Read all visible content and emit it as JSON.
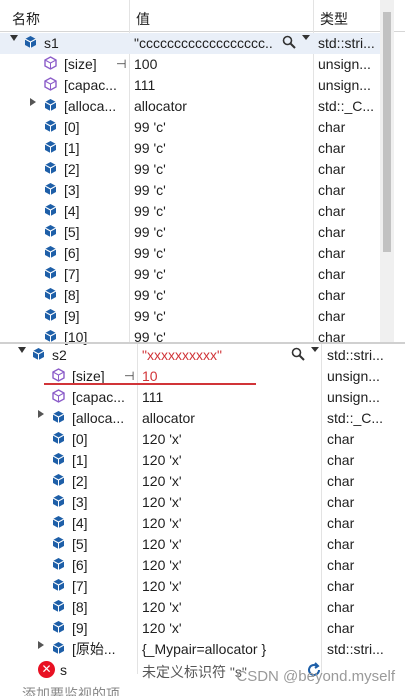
{
  "header": {
    "name": "名称",
    "value": "值",
    "type": "类型"
  },
  "s1": {
    "name": "s1",
    "value": "\"cccccccccccccccccc...",
    "type": "std::stri...",
    "rows": [
      {
        "name": "[size]",
        "value": "100",
        "type": "unsign..."
      },
      {
        "name": "[capac...",
        "value": "111",
        "type": "unsign..."
      },
      {
        "name": "[alloca...",
        "value": "allocator",
        "type": "std::_C..."
      },
      {
        "name": "[0]",
        "value": "99 'c'",
        "type": "char"
      },
      {
        "name": "[1]",
        "value": "99 'c'",
        "type": "char"
      },
      {
        "name": "[2]",
        "value": "99 'c'",
        "type": "char"
      },
      {
        "name": "[3]",
        "value": "99 'c'",
        "type": "char"
      },
      {
        "name": "[4]",
        "value": "99 'c'",
        "type": "char"
      },
      {
        "name": "[5]",
        "value": "99 'c'",
        "type": "char"
      },
      {
        "name": "[6]",
        "value": "99 'c'",
        "type": "char"
      },
      {
        "name": "[7]",
        "value": "99 'c'",
        "type": "char"
      },
      {
        "name": "[8]",
        "value": "99 'c'",
        "type": "char"
      },
      {
        "name": "[9]",
        "value": "99 'c'",
        "type": "char"
      },
      {
        "name": "[10]",
        "value": "99 'c'",
        "type": "char"
      }
    ]
  },
  "s2": {
    "name": "s2",
    "value": "\"xxxxxxxxxx\"",
    "type": "std::stri...",
    "rows": [
      {
        "name": "[size]",
        "value": "10",
        "type": "unsign..."
      },
      {
        "name": "[capac...",
        "value": "111",
        "type": "unsign..."
      },
      {
        "name": "[alloca...",
        "value": "allocator",
        "type": "std::_C..."
      },
      {
        "name": "[0]",
        "value": "120 'x'",
        "type": "char"
      },
      {
        "name": "[1]",
        "value": "120 'x'",
        "type": "char"
      },
      {
        "name": "[2]",
        "value": "120 'x'",
        "type": "char"
      },
      {
        "name": "[3]",
        "value": "120 'x'",
        "type": "char"
      },
      {
        "name": "[4]",
        "value": "120 'x'",
        "type": "char"
      },
      {
        "name": "[5]",
        "value": "120 'x'",
        "type": "char"
      },
      {
        "name": "[6]",
        "value": "120 'x'",
        "type": "char"
      },
      {
        "name": "[7]",
        "value": "120 'x'",
        "type": "char"
      },
      {
        "name": "[8]",
        "value": "120 'x'",
        "type": "char"
      },
      {
        "name": "[9]",
        "value": "120 'x'",
        "type": "char"
      },
      {
        "name": "[原始...",
        "value": "{_Mypair=allocator }",
        "type": "std::stri..."
      }
    ]
  },
  "error_row": {
    "name": "s",
    "value": "未定义标识符 \"s\""
  },
  "add_watch": "添加要监视的项",
  "watermark": "CSDN @beyond.myself",
  "colors": {
    "accent_red": "#d13438",
    "cube_blue": "#1e5fa8",
    "prop_purple": "#8b5cc9"
  }
}
